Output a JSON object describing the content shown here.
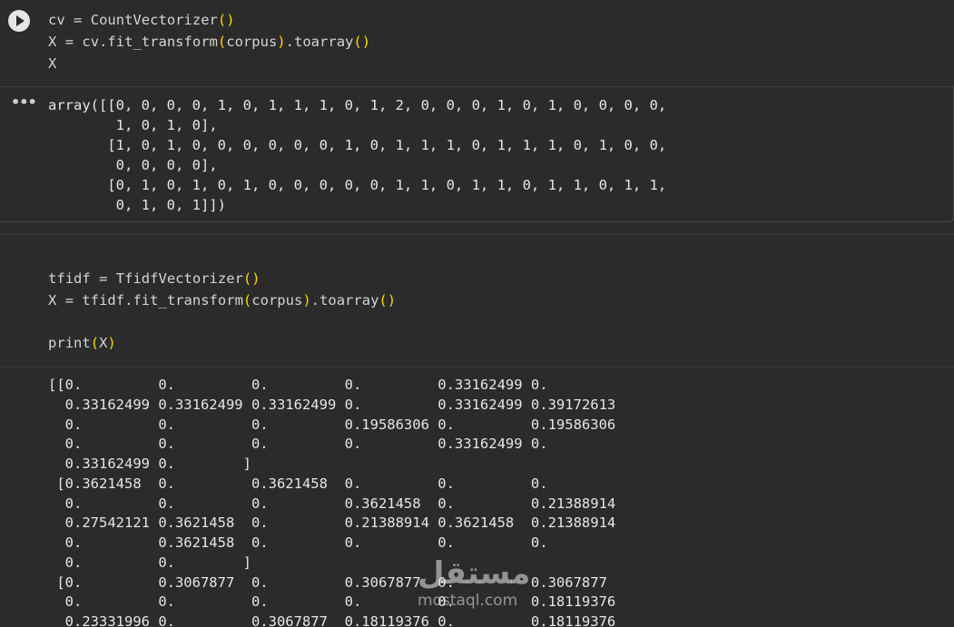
{
  "cell1": {
    "code": [
      "cv = CountVectorizer()",
      "X = cv.fit_transform(corpus).toarray()",
      "X"
    ],
    "output": [
      "array([[0, 0, 0, 0, 1, 0, 1, 1, 1, 0, 1, 2, 0, 0, 0, 1, 0, 1, 0, 0, 0, 0,",
      "        1, 0, 1, 0],",
      "       [1, 0, 1, 0, 0, 0, 0, 0, 0, 1, 0, 1, 1, 1, 0, 1, 1, 1, 0, 1, 0, 0,",
      "        0, 0, 0, 0],",
      "       [0, 1, 0, 1, 0, 1, 0, 0, 0, 0, 0, 1, 1, 0, 1, 1, 0, 1, 1, 0, 1, 1,",
      "        0, 1, 0, 1]])"
    ]
  },
  "cell2": {
    "code": [
      "tfidf = TfidfVectorizer()",
      "X = tfidf.fit_transform(corpus).toarray()",
      "",
      "print(X)"
    ],
    "output": [
      "[[0.         0.         0.         0.         0.33162499 0.",
      "  0.33162499 0.33162499 0.33162499 0.         0.33162499 0.39172613",
      "  0.         0.         0.         0.19586306 0.         0.19586306",
      "  0.         0.         0.         0.         0.33162499 0.",
      "  0.33162499 0.        ]",
      " [0.3621458  0.         0.3621458  0.         0.         0.",
      "  0.         0.         0.         0.3621458  0.         0.21388914",
      "  0.27542121 0.3621458  0.         0.21388914 0.3621458  0.21388914",
      "  0.         0.3621458  0.         0.         0.         0.",
      "  0.         0.        ]",
      " [0.         0.3067877  0.         0.3067877  0.         0.3067877",
      "  0.         0.         0.         0.         0.         0.18119376",
      "  0.23331996 0.         0.3067877  0.18119376 0.         0.18119376"
    ]
  },
  "watermark": {
    "logo": "مستقل",
    "domain": "mostaql.com"
  }
}
